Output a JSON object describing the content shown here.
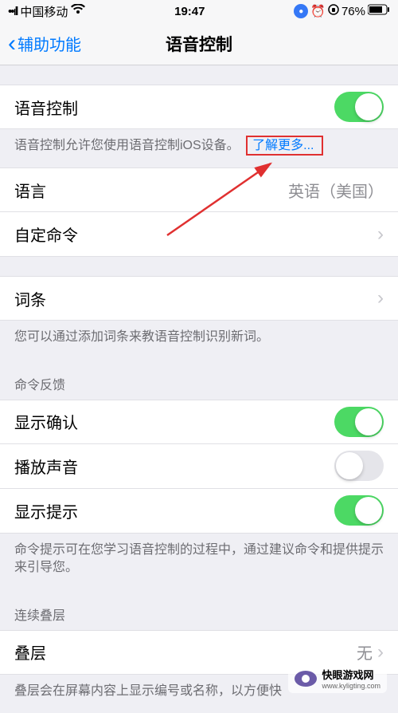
{
  "status": {
    "carrier": "中国移动",
    "time": "19:47",
    "battery": "76%"
  },
  "nav": {
    "back": "辅助功能",
    "title": "语音控制"
  },
  "voice_control": {
    "label": "语音控制",
    "footer": "语音控制允许您使用语音控制iOS设备。",
    "learn_more": "了解更多..."
  },
  "language": {
    "label": "语言",
    "value": "英语（美国）"
  },
  "custom_cmd": {
    "label": "自定命令"
  },
  "vocab": {
    "label": "词条",
    "footer": "您可以通过添加词条来教语音控制识别新词。"
  },
  "feedback": {
    "header": "命令反馈",
    "confirm": "显示确认",
    "sound": "播放声音",
    "hints": "显示提示",
    "footer": "命令提示可在您学习语音控制的过程中，通过建议命令和提供提示来引导您。"
  },
  "overlay": {
    "header": "连续叠层",
    "row": "叠层",
    "value": "无",
    "footer": "叠层会在屏幕内容上显示编号或名称，以方便快"
  },
  "watermark": {
    "name": "快眼游戏网",
    "url": "www.kyligting.com"
  }
}
